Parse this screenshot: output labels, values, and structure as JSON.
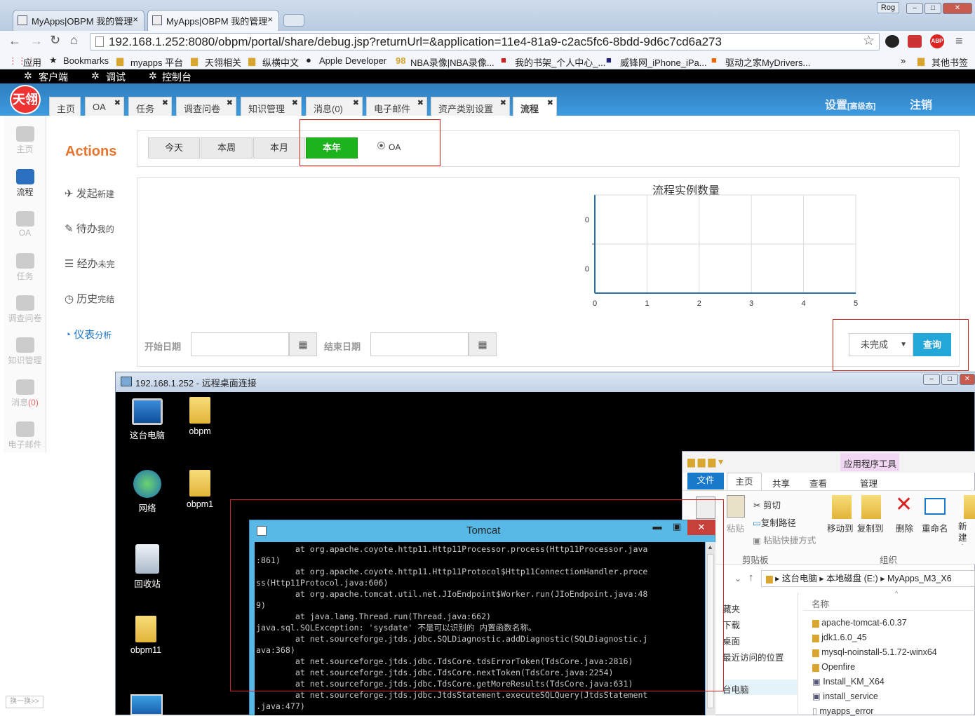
{
  "browser": {
    "tabs": [
      {
        "title": "MyApps|OBPM 我的管理",
        "close": "×"
      },
      {
        "title": "MyApps|OBPM 我的管理",
        "close": "×"
      }
    ],
    "user_badge": "Rog",
    "url": "192.168.1.252:8080/obpm/portal/share/debug.jsp?returnUrl=&application=11e4-81a9-c2ac5fc6-8bdd-9d6c7cd6a273",
    "bookmarks": [
      "应用",
      "Bookmarks",
      "myapps 平台",
      "天翎相关",
      "纵横中文",
      "Apple Developer",
      "NBA录像|NBA录像...",
      "我的书架_个人中心_...",
      "威锋网_iPhone_iPa...",
      "驱动之家MyDrivers..."
    ],
    "bookmarks_more": "»",
    "other_bookmarks": "其他书签"
  },
  "app": {
    "topbar": [
      "客户端",
      "调试",
      "控制台"
    ],
    "logo_text": "天翎",
    "tabs": [
      {
        "label": "主页",
        "closable": false
      },
      {
        "label": "OA",
        "closable": true
      },
      {
        "label": "任务",
        "closable": true
      },
      {
        "label": "调查问卷",
        "closable": true
      },
      {
        "label": "知识管理",
        "closable": true
      },
      {
        "label": "消息(0)",
        "closable": true
      },
      {
        "label": "电子邮件",
        "closable": true
      },
      {
        "label": "资产类别设置",
        "closable": true
      },
      {
        "label": "流程",
        "closable": true
      }
    ],
    "settings_link": "设置",
    "settings_sub": "[高级态]",
    "logout_link": "注销",
    "left_nav": [
      "主页",
      "流程",
      "OA",
      "任务",
      "调查问卷",
      "知识管理",
      "消息",
      "电子邮件"
    ],
    "msg_count": "(0)",
    "left_bottom": "换一换>>",
    "actions_title": "Actions",
    "actions": [
      {
        "main": "发起",
        "sub": "新建"
      },
      {
        "main": "待办",
        "sub": "我的"
      },
      {
        "main": "经办",
        "sub": "未完"
      },
      {
        "main": "历史",
        "sub": "完结"
      },
      {
        "main": "仪表",
        "sub": "分析"
      }
    ],
    "period_buttons": [
      "今天",
      "本周",
      "本月",
      "本年"
    ],
    "radio_label": "OA",
    "start_date_label": "开始日期",
    "end_date_label": "结束日期",
    "status_select": "未完成",
    "query_button": "查询"
  },
  "chart_data": {
    "type": "line",
    "title": "流程实例数量",
    "x": [
      0,
      1,
      2,
      3,
      4,
      5
    ],
    "ytick_labels": [
      "0",
      "0"
    ],
    "series": [],
    "grid": true
  },
  "rdp": {
    "title": "192.168.1.252 - 远程桌面连接",
    "desktop_icons": [
      "这台电脑",
      "obpm",
      "网络",
      "obpm1",
      "回收站",
      "obpm11"
    ]
  },
  "explorer": {
    "context_tab": "应用程序工具",
    "ribbon_tabs": [
      "文件",
      "主页",
      "共享",
      "查看",
      "管理"
    ],
    "paste": "粘贴",
    "cut": "剪切",
    "copy_path": "复制路径",
    "paste_shortcut": "粘贴快捷方式",
    "clipboard_group": "剪贴板",
    "move_to": "移动到",
    "copy_to": "复制到",
    "delete": "删除",
    "rename": "重命名",
    "new_folder": "新建文件",
    "organize_group": "组织",
    "breadcrumb": [
      "这台电脑",
      "本地磁盘 (E:)",
      "MyApps_M3_X6"
    ],
    "nav_items": [
      "藏夹",
      "下载",
      "桌面",
      "最近访问的位置",
      "台电脑"
    ],
    "column_name": "名称",
    "files": [
      "apache-tomcat-6.0.37",
      "jdk1.6.0_45",
      "mysql-noinstall-5.1.72-winx64",
      "Openfire",
      "Install_KM_X64",
      "install_service",
      "myapps_error"
    ]
  },
  "tomcat": {
    "title": "Tomcat",
    "console": "        at org.apache.coyote.http11.Http11Processor.process(Http11Processor.java\n:861)\n        at org.apache.coyote.http11.Http11Protocol$Http11ConnectionHandler.proce\nss(Http11Protocol.java:606)\n        at org.apache.tomcat.util.net.JIoEndpoint$Worker.run(JIoEndpoint.java:48\n9)\n        at java.lang.Thread.run(Thread.java:662)\njava.sql.SQLException: 'sysdate' 不是可以识别的 内置函数名称。\n        at net.sourceforge.jtds.jdbc.SQLDiagnostic.addDiagnostic(SQLDiagnostic.j\nava:368)\n        at net.sourceforge.jtds.jdbc.TdsCore.tdsErrorToken(TdsCore.java:2816)\n        at net.sourceforge.jtds.jdbc.TdsCore.nextToken(TdsCore.java:2254)\n        at net.sourceforge.jtds.jdbc.TdsCore.getMoreResults(TdsCore.java:631)\n        at net.sourceforge.jtds.jdbc.JtdsStatement.executeSQLQuery(JtdsStatement\n.java:477)"
  }
}
